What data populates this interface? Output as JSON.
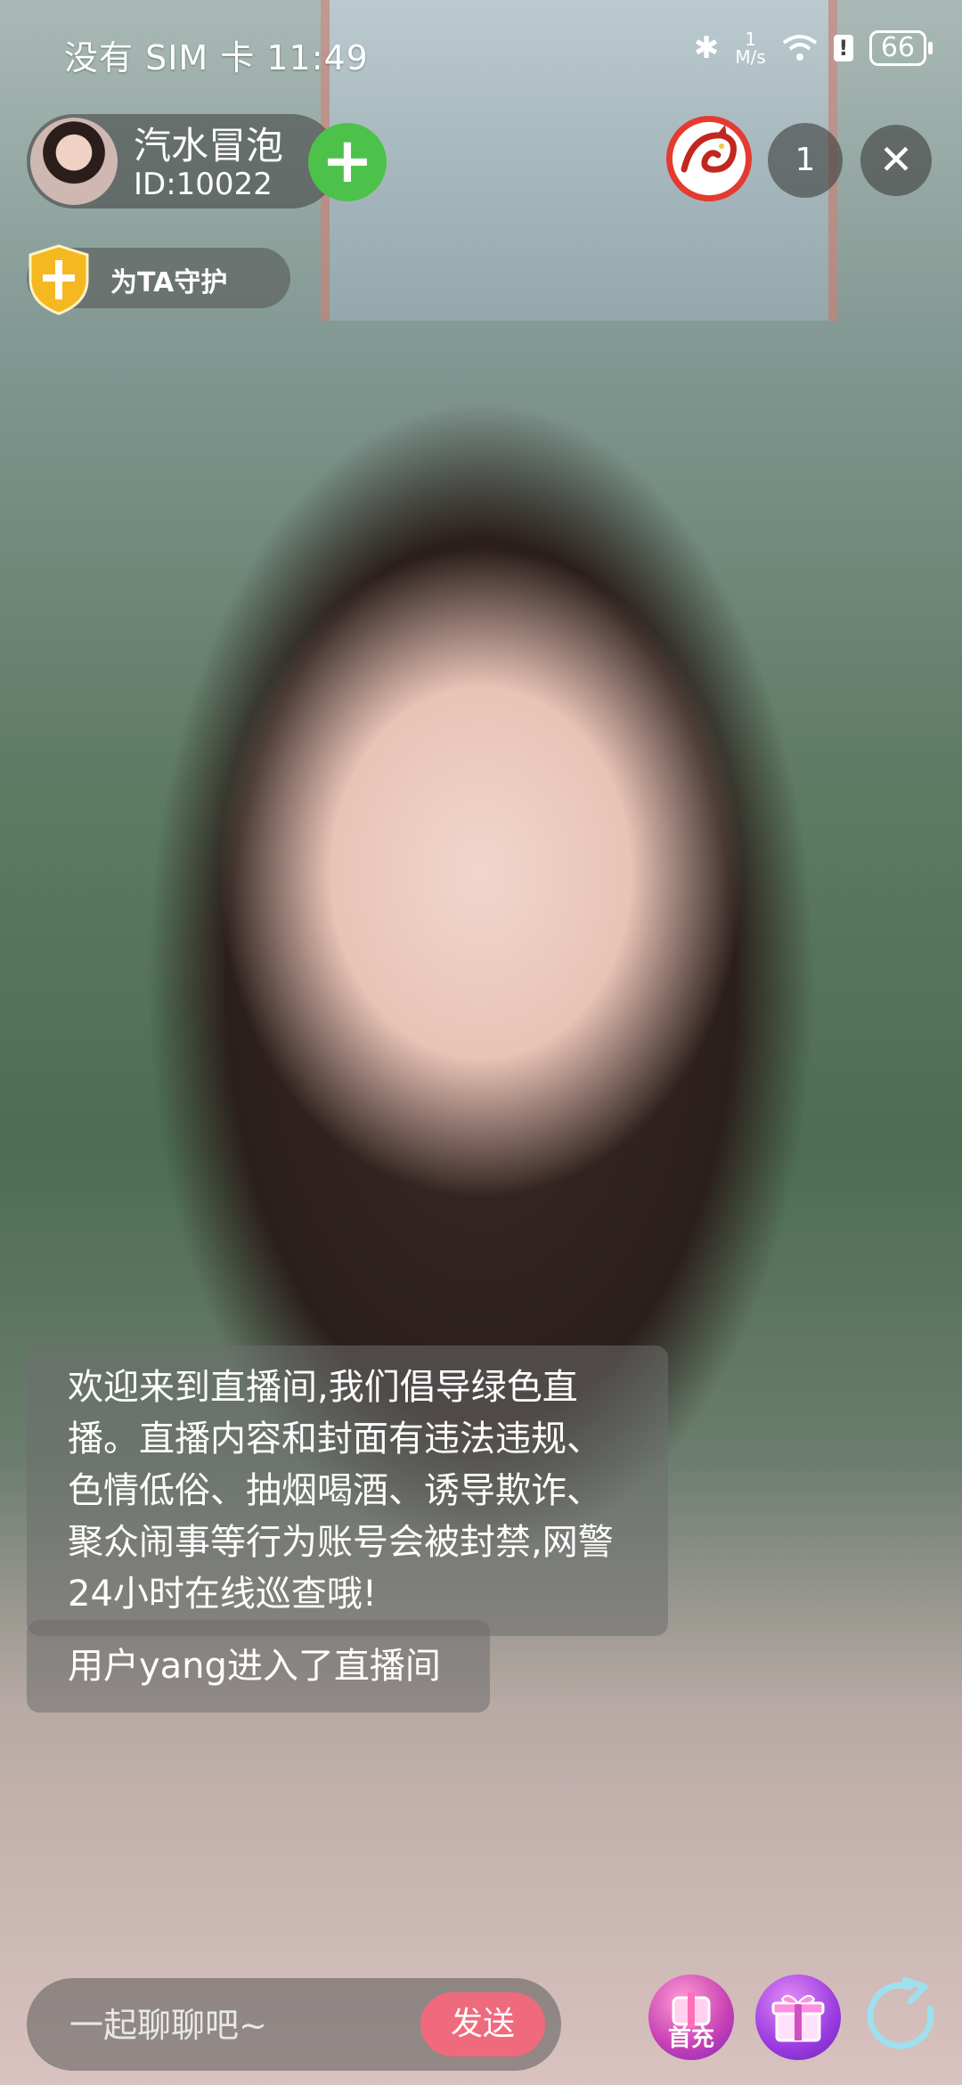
{
  "status_bar": {
    "carrier_time": "没有 SIM 卡 11:49",
    "net_speed_value": "1",
    "net_speed_unit": "M/s",
    "battery": "66"
  },
  "host": {
    "name": "汽水冒泡",
    "id": "ID:10022"
  },
  "guard": {
    "label": "为TA守护"
  },
  "viewers": {
    "count": "1"
  },
  "messages": {
    "notice": "欢迎来到直播间,我们倡导绿色直播。直播内容和封面有违法违规、色情低俗、抽烟喝酒、诱导欺诈、聚众闹事等行为账号会被封禁,网警24小时在线巡查哦!",
    "entered": "用户yang进入了直播间"
  },
  "chat": {
    "placeholder": "一起聊聊吧~",
    "send_label": "发送"
  },
  "actions": {
    "recharge_label": "首充"
  },
  "colors": {
    "send_button": "#f06a7d",
    "follow_button": "#4cc24a",
    "guard_shield": "#f5b820"
  },
  "icons": [
    "bluetooth-icon",
    "wifi-icon",
    "alert-icon",
    "battery-icon",
    "plus-icon",
    "shield-icon",
    "dragon-logo-icon",
    "close-icon",
    "recharge-icon",
    "gift-icon",
    "share-icon"
  ]
}
